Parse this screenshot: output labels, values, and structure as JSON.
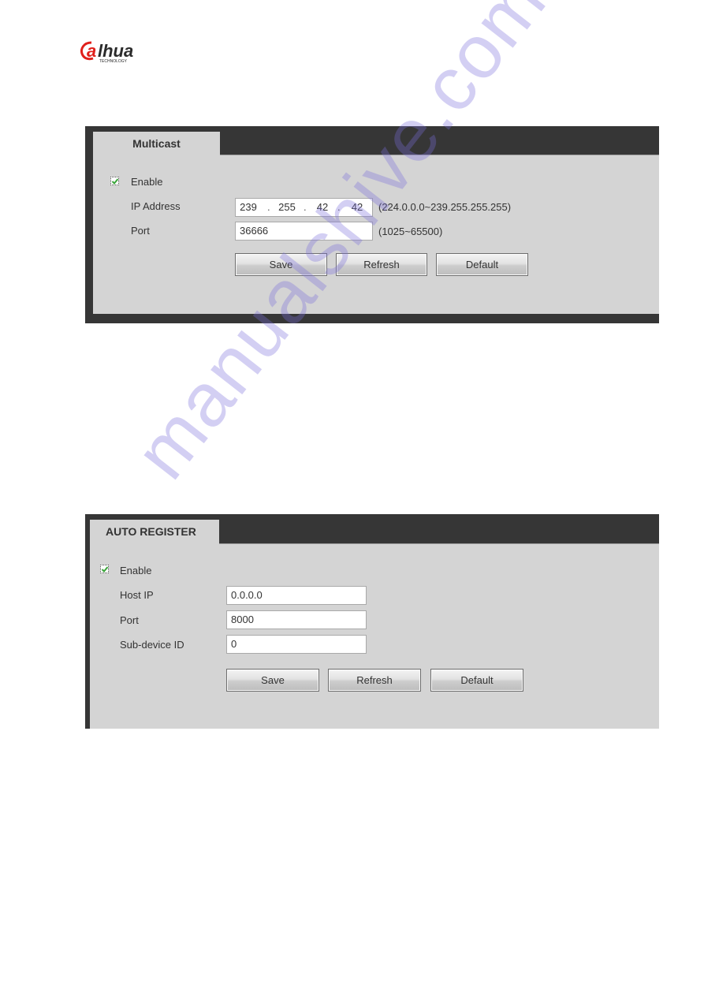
{
  "brand": {
    "name": "alhua",
    "tagline": "TECHNOLOGY",
    "colors": {
      "red": "#e0201b",
      "dark": "#2b2b2b"
    }
  },
  "multicast": {
    "tab_label": "Multicast",
    "enable": {
      "label": "Enable",
      "checked": true
    },
    "ip_address": {
      "label": "IP Address",
      "octets": [
        "239",
        "255",
        "42",
        "42"
      ],
      "range_hint": "(224.0.0.0~239.255.255.255)"
    },
    "port": {
      "label": "Port",
      "value": "36666",
      "range_hint": "(1025~65500)"
    },
    "buttons": {
      "save": "Save",
      "refresh": "Refresh",
      "default": "Default"
    }
  },
  "auto_register": {
    "tab_label": "AUTO REGISTER",
    "enable": {
      "label": "Enable",
      "checked": true
    },
    "host_ip": {
      "label": "Host IP",
      "value": "0.0.0.0"
    },
    "port": {
      "label": "Port",
      "value": "8000"
    },
    "sub_device_id": {
      "label": "Sub-device ID",
      "value": "0"
    },
    "buttons": {
      "save": "Save",
      "refresh": "Refresh",
      "default": "Default"
    }
  },
  "watermark": "manualshive.com",
  "colors": {
    "panel_dark": "#363636",
    "panel_body": "#d4d4d4",
    "check_green": "#3aa53a"
  }
}
